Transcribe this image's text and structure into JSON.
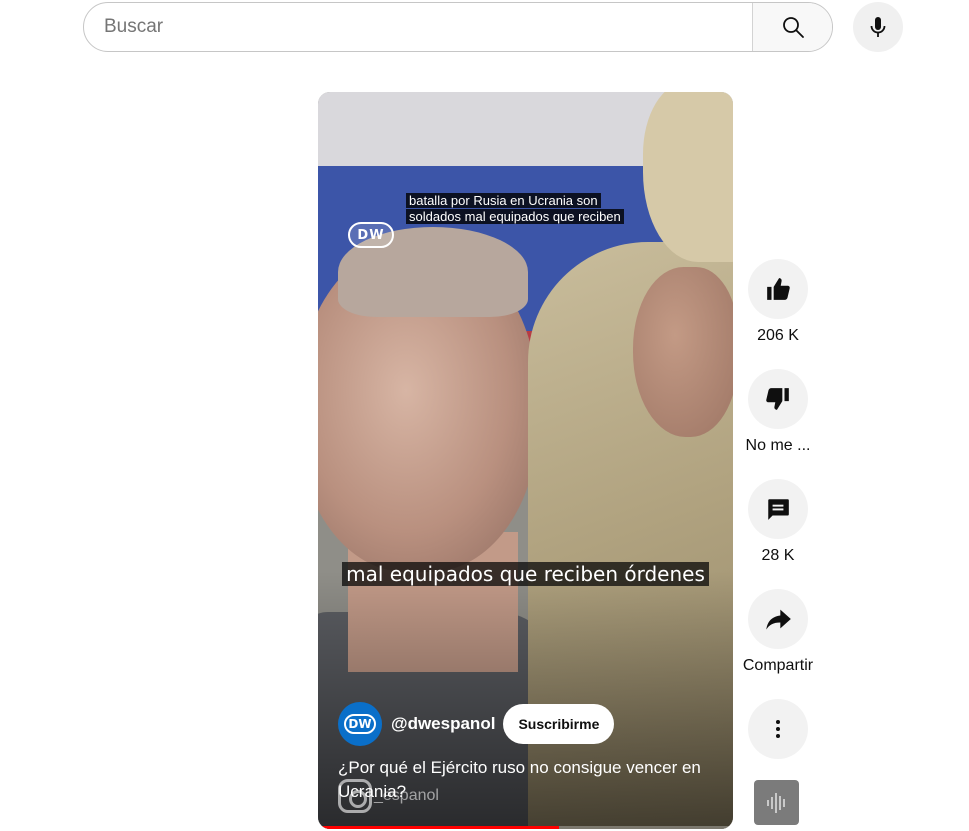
{
  "search": {
    "placeholder": "Buscar",
    "value": ""
  },
  "video": {
    "caption_top": "batalla por Rusia en Ucrania son soldados mal equipados que reciben",
    "logo_text": "DW",
    "subtitle": "mal equipados que reciben órdenes",
    "progress_fraction": 0.58
  },
  "channel": {
    "avatar_text": "DW",
    "handle": "@dwespanol",
    "subscribe_label": "Suscribirme",
    "title": "¿Por qué el Ejército ruso no consigue vencer en Ucrania?",
    "watermark_handle": "_espanol"
  },
  "actions": {
    "like_count": "206 K",
    "dislike_label": "No me ...",
    "comments_count": "28 K",
    "share_label": "Compartir"
  },
  "colors": {
    "progress": "#ff0000",
    "channel_avatar": "#0a6fc9",
    "flag_blue": "#3c55a8",
    "flag_red": "#b63c44"
  },
  "icons": {
    "search": "search-icon",
    "mic": "microphone-icon",
    "like": "thumbs-up-icon",
    "dislike": "thumbs-down-icon",
    "comments": "comment-icon",
    "share": "share-arrow-icon",
    "more": "more-vertical-icon",
    "audio": "audio-waveform-icon"
  }
}
